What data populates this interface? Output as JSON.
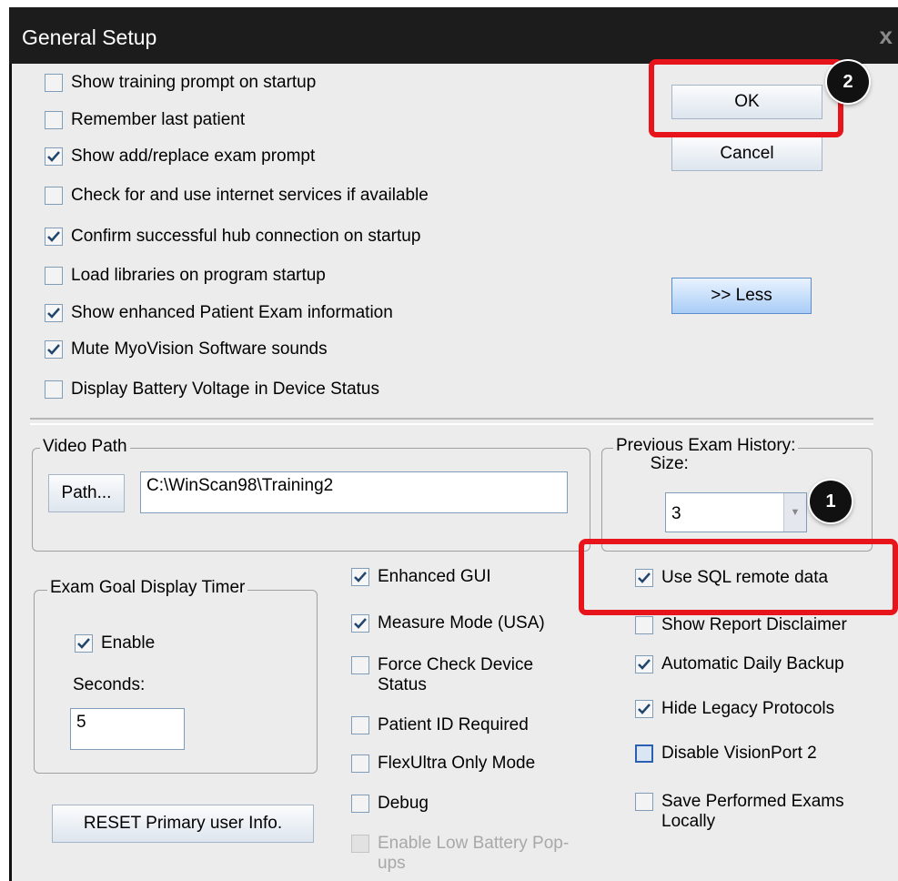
{
  "window": {
    "title": "General Setup",
    "close_glyph": "x"
  },
  "top_checkboxes": [
    {
      "label": "Show training prompt on startup",
      "checked": false
    },
    {
      "label": "Remember last patient",
      "checked": false
    },
    {
      "label": "Show add/replace exam prompt",
      "checked": true
    },
    {
      "label": "Check for and use internet services if available",
      "checked": false
    },
    {
      "label": "Confirm successful hub connection on startup",
      "checked": true
    },
    {
      "label": "Load libraries on program startup",
      "checked": false
    },
    {
      "label": "Show enhanced Patient Exam information",
      "checked": true
    },
    {
      "label": "Mute MyoVision Software sounds",
      "checked": true
    },
    {
      "label": "Display Battery Voltage in Device Status",
      "checked": false
    }
  ],
  "buttons": {
    "ok": "OK",
    "cancel": "Cancel",
    "less": ">> Less",
    "path": "Path...",
    "reset": "RESET Primary user Info."
  },
  "video_path": {
    "group_title": "Video Path",
    "value": "C:\\WinScan98\\Training2"
  },
  "exam_history": {
    "group_title_line1": "Previous Exam History:",
    "group_title_line2": "Size:",
    "value": "3"
  },
  "exam_goal": {
    "group_title": "Exam Goal Display Timer",
    "enable_label": "Enable",
    "enable_checked": true,
    "seconds_label": "Seconds:",
    "seconds_value": "5"
  },
  "middle_checkboxes": [
    {
      "label": "Enhanced GUI",
      "checked": true
    },
    {
      "label": "Measure Mode (USA)",
      "checked": true
    },
    {
      "label": "Force Check Device Status",
      "checked": false
    },
    {
      "label": "Patient ID Required",
      "checked": false
    },
    {
      "label": "FlexUltra Only Mode",
      "checked": false
    },
    {
      "label": "Debug",
      "checked": false
    },
    {
      "label": "Enable Low Battery Pop-ups",
      "checked": false,
      "disabled": true
    }
  ],
  "right_checkboxes": [
    {
      "label": "Use SQL remote data",
      "checked": true
    },
    {
      "label": "Show Report Disclaimer",
      "checked": false
    },
    {
      "label": "Automatic Daily Backup",
      "checked": true
    },
    {
      "label": "Hide Legacy Protocols",
      "checked": true
    },
    {
      "label": "Disable VisionPort 2",
      "checked": false
    },
    {
      "label": "Save Performed Exams Locally",
      "checked": false
    }
  ],
  "annotations": {
    "badge_1": "1",
    "badge_2": "2",
    "highlight_color": "#e8141c"
  }
}
